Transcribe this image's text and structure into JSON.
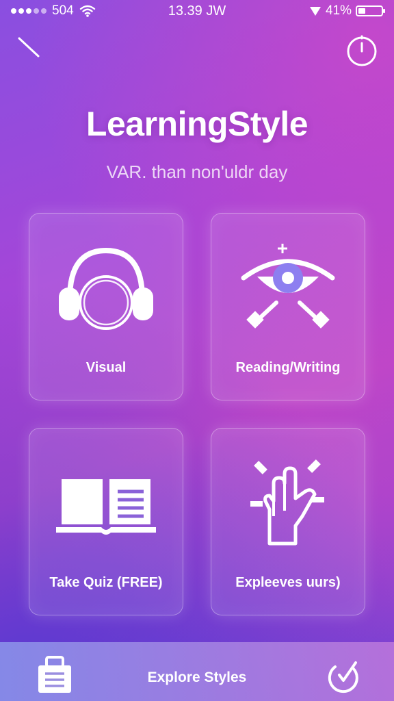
{
  "status_bar": {
    "carrier": "504",
    "time": "13.39 JW",
    "battery_text": "41%",
    "battery_level": 0.28
  },
  "header": {
    "title": "LearningStyle",
    "subtitle": "VAR. than non'uldr day"
  },
  "cards": [
    {
      "label": "Visual",
      "icon": "headphones-icon"
    },
    {
      "label": "Reading/Writing",
      "icon": "eye-icon"
    },
    {
      "label": "Take Quiz (FREE)",
      "icon": "open-book-icon"
    },
    {
      "label": "Expleeves uurs)",
      "icon": "hand-icon"
    }
  ],
  "bottom_nav": {
    "center_label": "Explore Styles",
    "left_icon": "briefcase-icon",
    "right_icon": "refresh-check-icon"
  }
}
